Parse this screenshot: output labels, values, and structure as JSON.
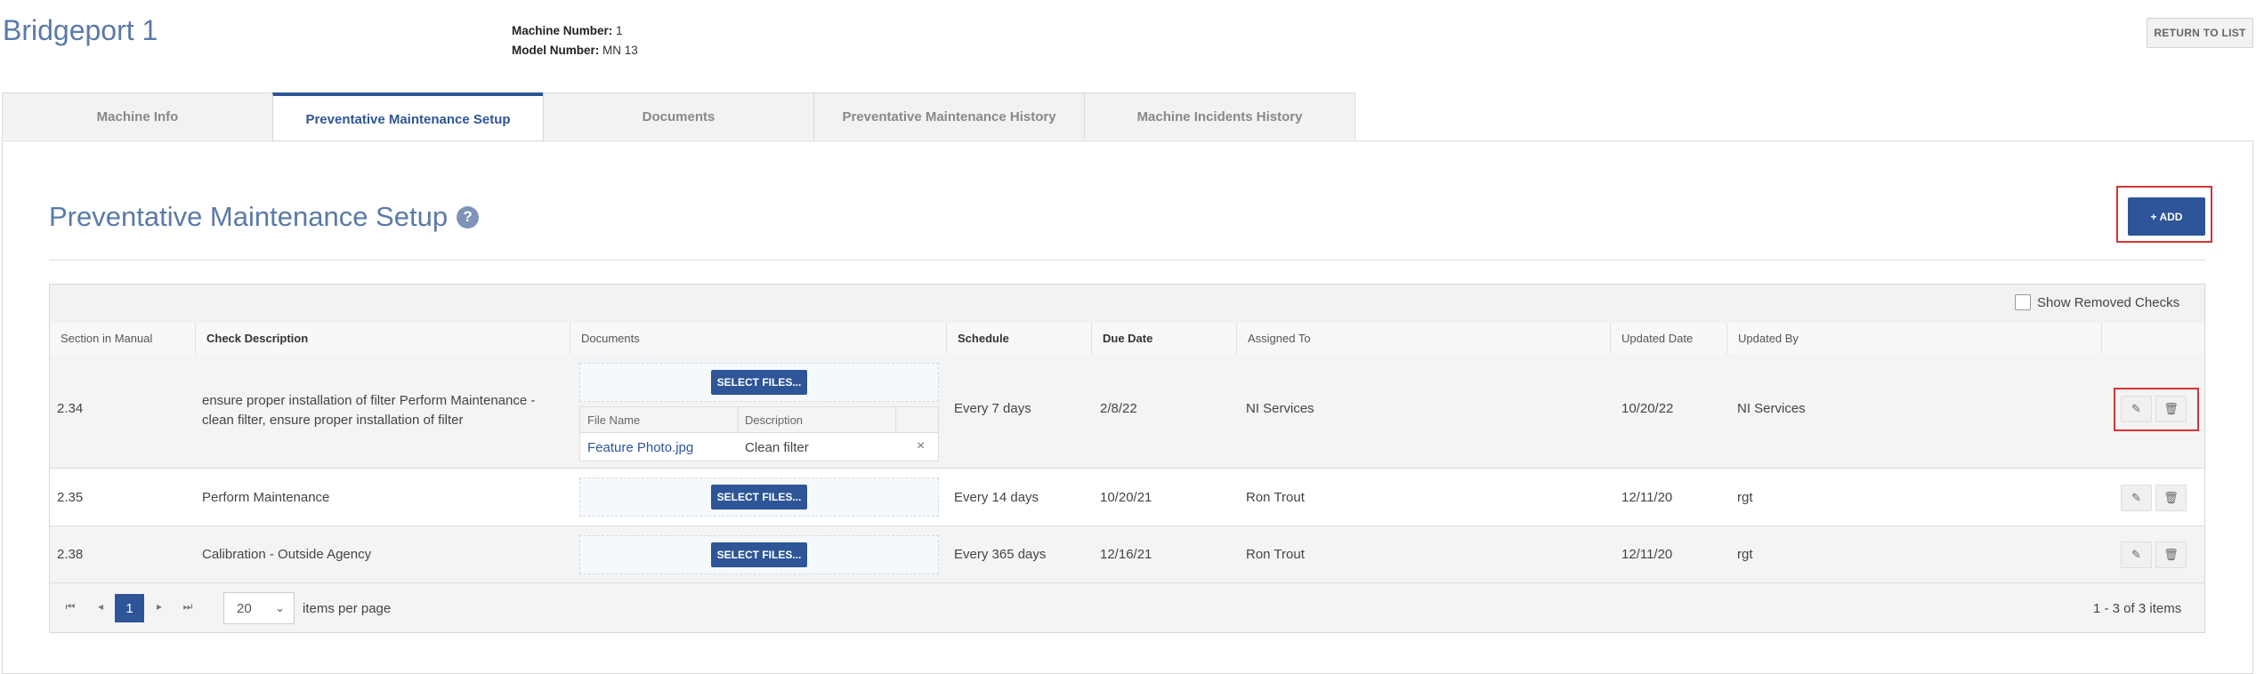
{
  "header": {
    "title": "Bridgeport 1",
    "machine_number_label": "Machine Number:",
    "machine_number": "1",
    "model_number_label": "Model Number:",
    "model_number": "MN 13",
    "return_label": "RETURN TO LIST"
  },
  "tabs": [
    {
      "label": "Machine Info"
    },
    {
      "label": "Preventative Maintenance Setup"
    },
    {
      "label": "Documents"
    },
    {
      "label": "Preventative Maintenance History"
    },
    {
      "label": "Machine Incidents History"
    }
  ],
  "section": {
    "title": "Preventative Maintenance Setup",
    "help_glyph": "?",
    "add_label": "+ ADD"
  },
  "grid": {
    "show_removed_label": "Show Removed Checks",
    "columns": {
      "section": "Section in Manual",
      "description": "Check Description",
      "documents": "Documents",
      "schedule": "Schedule",
      "due": "Due Date",
      "assigned": "Assigned To",
      "updated_date": "Updated Date",
      "updated_by": "Updated By"
    },
    "select_files_label": "SELECT FILES...",
    "file_table": {
      "col_name": "File Name",
      "col_desc": "Description"
    },
    "rows": [
      {
        "section": "2.34",
        "description": "ensure proper installation of filter Perform Maintenance - clean filter, ensure proper installation of filter",
        "file_name": "Feature Photo.jpg",
        "file_desc": "Clean filter",
        "remove_glyph": "×",
        "schedule": "Every 7 days",
        "due": "2/8/22",
        "assigned": "NI Services",
        "updated_date": "10/20/22",
        "updated_by": "NI Services"
      },
      {
        "section": "2.35",
        "description": "Perform Maintenance",
        "schedule": "Every 14 days",
        "due": "10/20/21",
        "assigned": "Ron Trout",
        "updated_date": "12/11/20",
        "updated_by": "rgt"
      },
      {
        "section": "2.38",
        "description": "Calibration - Outside Agency",
        "schedule": "Every 365 days",
        "due": "12/16/21",
        "assigned": "Ron Trout",
        "updated_date": "12/11/20",
        "updated_by": "rgt"
      }
    ]
  },
  "pager": {
    "current_page": "1",
    "page_size": "20",
    "items_per_page_label": "items per page",
    "range_text": "1 - 3 of 3 items"
  },
  "icons": {
    "first": "⏮",
    "prev": "◂",
    "next": "▸",
    "last": "⏭",
    "edit": "✎",
    "delete": "🗑",
    "dropdown": "⌄"
  },
  "colors": {
    "accent": "#2d5597",
    "title": "#5a7aa8",
    "highlight": "#d23535"
  }
}
